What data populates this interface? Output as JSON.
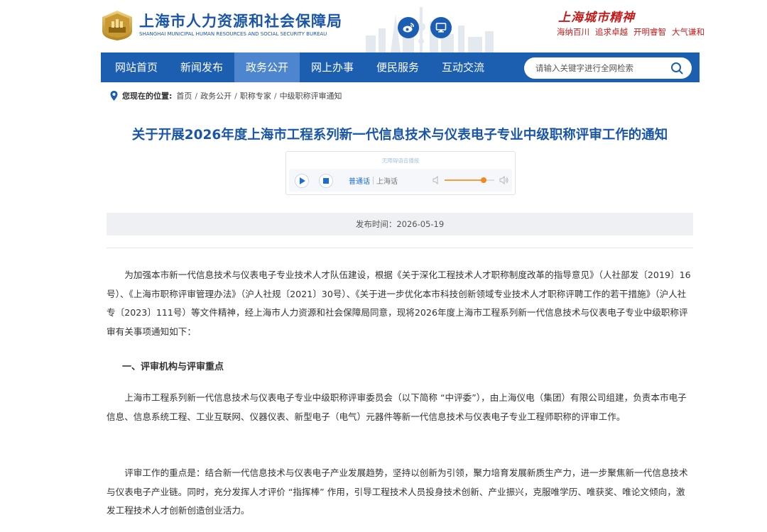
{
  "header": {
    "logo_cn": "上海市人力资源和社会保障局",
    "logo_en": "SHANGHAI MUNICIPAL HUMAN RESOURCES AND SOCIAL SECURITY BUREAU",
    "social_icons": [
      "weibo-icon",
      "monitor-icon"
    ],
    "city_spirit_title": "上海城市精神",
    "city_spirit_words": [
      "海纳百川",
      "追求卓越",
      "开明睿智",
      "大气谦和"
    ]
  },
  "nav": {
    "items": [
      {
        "label": "网站首页",
        "active": false
      },
      {
        "label": "新闻发布",
        "active": false
      },
      {
        "label": "政务公开",
        "active": true
      },
      {
        "label": "网上办事",
        "active": false
      },
      {
        "label": "便民服务",
        "active": false
      },
      {
        "label": "互动交流",
        "active": false
      }
    ],
    "search_placeholder": "请输入关键字进行全网检索"
  },
  "breadcrumb": {
    "label": "您现在的位置:",
    "items": [
      "首页",
      "政务公开",
      "职称专家",
      "中级职称评审通知"
    ]
  },
  "article": {
    "title": "关于开展2026年度上海市工程系列新一代信息技术与仪表电子专业中级职称评审工作的通知",
    "publish_date": "发布时间：2026-05-19",
    "paragraphs": [
      "为加强本市新一代信息技术与仪表电子专业技术人才队伍建设，根据《关于深化工程技术人才职称制度改革的指导意见》（人社部发〔2019〕16号）、《上海市职称评审管理办法》（沪人社规〔2021〕30号）、《关于进一步优化本市科技创新领域专业技术人才职称评聘工作的若干措施》（沪人社专〔2023〕111号）等文件精神，经上海市人力资源和社会保障局同意，现将2026年度上海市工程系列新一代信息技术与仪表电子专业中级职称评审有关事项通知如下：",
      "上海市工程系列新一代信息技术与仪表电子专业中级职称评审委员会（以下简称 “中评委”），由上海仪电（集团）有限公司组建，负责本市电子信息、信息系统工程、工业互联网、仪器仪表、新型电子（电气）元器件等新一代信息技术与仪表电子专业工程师职称的评审工作。",
      "评审工作的重点是：结合新一代信息技术与仪表电子产业发展趋势，坚持以创新为引领，聚力培育发展新质生产力，进一步聚焦新一代信息技术与仪表电子产业链。同时，充分发挥人才评价 “指挥棒” 作用，引导工程技术人员投身技术创新、产业振兴，克服唯学历、唯获奖、唯论文倾向，激发工程技术人才创新创造创业活力。"
    ],
    "section_heading": "一、评审机构与评审重点"
  },
  "player": {
    "brand": "无障碍语音播报",
    "lang_options": [
      "普通话",
      "上海话"
    ],
    "selected_lang": "普通话",
    "volume_level": 0.78,
    "accent_color": "#f08a1c"
  },
  "colors": {
    "brand_blue": "#1c5fb0",
    "nav_active": "#4d86cf",
    "title_blue": "#1a56a7",
    "spirit_red": "#c51b1b"
  }
}
